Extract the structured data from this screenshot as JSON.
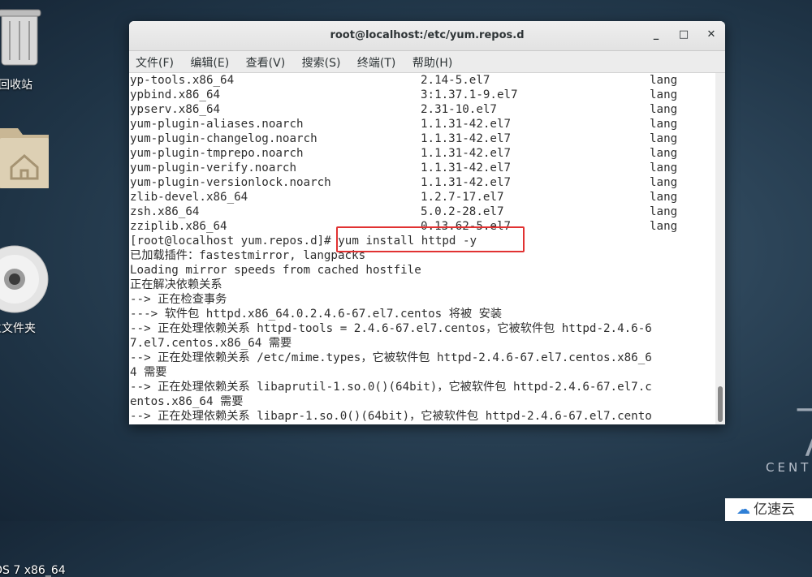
{
  "desktop": {
    "icons": [
      {
        "label": "回收站"
      },
      {
        "label": "主文件夹"
      },
      {
        "label": "OS 7 x86_64"
      }
    ],
    "centos_text": "CENT"
  },
  "window": {
    "title": "root@localhost:/etc/yum.repos.d",
    "min_glyph": "_",
    "max_glyph": "□",
    "close_glyph": "✕",
    "menu": [
      "文件(F)",
      "编辑(E)",
      "查看(V)",
      "搜索(S)",
      "终端(T)",
      "帮助(H)"
    ]
  },
  "terminal": {
    "packages": [
      {
        "name": "yp-tools.x86_64",
        "version": "2.14-5.el7",
        "repo": "lang"
      },
      {
        "name": "ypbind.x86_64",
        "version": "3:1.37.1-9.el7",
        "repo": "lang"
      },
      {
        "name": "ypserv.x86_64",
        "version": "2.31-10.el7",
        "repo": "lang"
      },
      {
        "name": "yum-plugin-aliases.noarch",
        "version": "1.1.31-42.el7",
        "repo": "lang"
      },
      {
        "name": "yum-plugin-changelog.noarch",
        "version": "1.1.31-42.el7",
        "repo": "lang"
      },
      {
        "name": "yum-plugin-tmprepo.noarch",
        "version": "1.1.31-42.el7",
        "repo": "lang"
      },
      {
        "name": "yum-plugin-verify.noarch",
        "version": "1.1.31-42.el7",
        "repo": "lang"
      },
      {
        "name": "yum-plugin-versionlock.noarch",
        "version": "1.1.31-42.el7",
        "repo": "lang"
      },
      {
        "name": "zlib-devel.x86_64",
        "version": "1.2.7-17.el7",
        "repo": "lang"
      },
      {
        "name": "zsh.x86_64",
        "version": "5.0.2-28.el7",
        "repo": "lang"
      },
      {
        "name": "zziplib.x86_64",
        "version": "0.13.62-5.el7",
        "repo": "lang"
      }
    ],
    "output": [
      "[root@localhost yum.repos.d]# yum install httpd -y",
      "已加载插件：fastestmirror, langpacks",
      "Loading mirror speeds from cached hostfile",
      "正在解决依赖关系",
      "--> 正在检查事务",
      "---> 软件包 httpd.x86_64.0.2.4.6-67.el7.centos 将被 安装",
      "--> 正在处理依赖关系 httpd-tools = 2.4.6-67.el7.centos，它被软件包 httpd-2.4.6-6",
      "7.el7.centos.x86_64 需要",
      "--> 正在处理依赖关系 /etc/mime.types，它被软件包 httpd-2.4.6-67.el7.centos.x86_6",
      "4 需要",
      "--> 正在处理依赖关系 libaprutil-1.so.0()(64bit)，它被软件包 httpd-2.4.6-67.el7.c",
      "entos.x86_64 需要",
      "--> 正在处理依赖关系 libapr-1.so.0()(64bit)，它被软件包 httpd-2.4.6-67.el7.cento"
    ]
  },
  "watermark": {
    "text": "亿速云",
    "icon": "cloud-icon"
  }
}
